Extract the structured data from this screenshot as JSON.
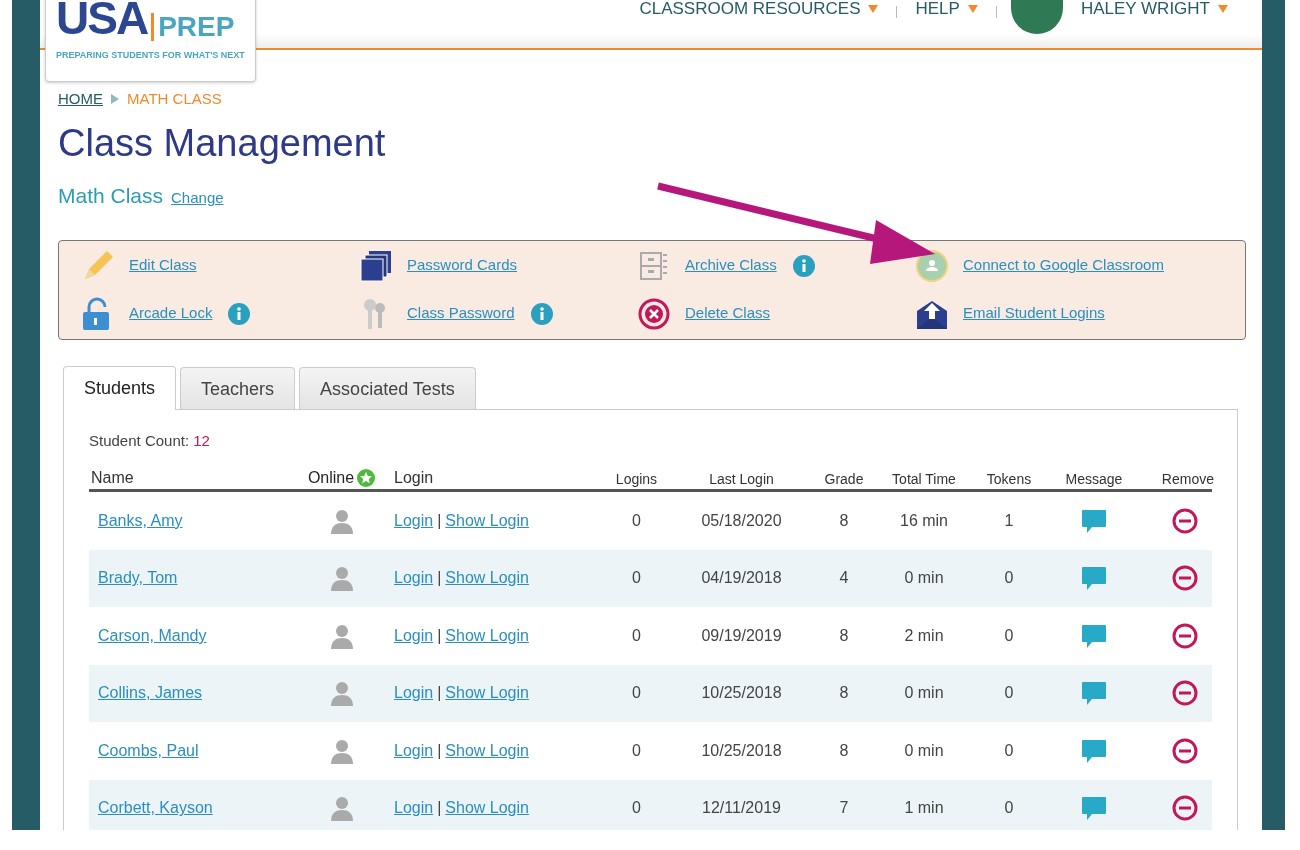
{
  "header": {
    "logo": {
      "main": "USA",
      "sub": "PREP",
      "tagline": "PREPARING STUDENTS FOR WHAT'S NEXT"
    },
    "nav": [
      {
        "label": "CLASSROOM RESOURCES",
        "kind": "menu"
      },
      {
        "label": "HELP",
        "kind": "menu"
      },
      {
        "label": "HALEY WRIGHT",
        "kind": "user"
      }
    ]
  },
  "breadcrumb": [
    {
      "label": "HOME",
      "kind": "link"
    },
    {
      "label": "MATH CLASS",
      "kind": "current"
    }
  ],
  "title": "Class Management",
  "class_name": "Math Class",
  "change_link": "Change",
  "actions": [
    {
      "label": "Edit Class",
      "kind": "pencil",
      "info": false
    },
    {
      "label": "Password Cards",
      "kind": "cards",
      "info": false
    },
    {
      "label": "Archive Class",
      "kind": "archive",
      "info": true
    },
    {
      "label": "Connect to Google Classroom",
      "kind": "classroom",
      "info": false
    },
    {
      "label": "Arcade Lock",
      "kind": "lock",
      "info": true
    },
    {
      "label": "Class Password",
      "kind": "keys",
      "info": true
    },
    {
      "label": "Delete Class",
      "kind": "delete",
      "info": false
    },
    {
      "label": "Email Student Logins",
      "kind": "email",
      "info": false
    }
  ],
  "tabs": [
    {
      "label": "Students",
      "selected": true
    },
    {
      "label": "Teachers",
      "selected": false
    },
    {
      "label": "Associated Tests",
      "selected": false
    }
  ],
  "student_count": {
    "label": "Student Count:",
    "value": "12"
  },
  "table": {
    "columns": [
      "Name",
      "Online",
      "Login",
      "Logins",
      "Last Login",
      "Grade",
      "Total Time",
      "Tokens",
      "Message",
      "Remove"
    ],
    "rows": [
      {
        "name": "Banks, Amy",
        "login_link": "Login",
        "separator": "|",
        "show_login_link": "Show Login",
        "logins": "0",
        "last_login": "05/18/2020",
        "grade": "8",
        "total_time": "16 min",
        "tokens": "1"
      },
      {
        "name": "Brady, Tom",
        "login_link": "Login",
        "separator": "|",
        "show_login_link": "Show Login",
        "logins": "0",
        "last_login": "04/19/2018",
        "grade": "4",
        "total_time": "0 min",
        "tokens": "0"
      },
      {
        "name": "Carson, Mandy",
        "login_link": "Login",
        "separator": "|",
        "show_login_link": "Show Login",
        "logins": "0",
        "last_login": "09/19/2019",
        "grade": "8",
        "total_time": "2 min",
        "tokens": "0"
      },
      {
        "name": "Collins, James",
        "login_link": "Login",
        "separator": "|",
        "show_login_link": "Show Login",
        "logins": "0",
        "last_login": "10/25/2018",
        "grade": "8",
        "total_time": "0 min",
        "tokens": "0"
      },
      {
        "name": "Coombs, Paul",
        "login_link": "Login",
        "separator": "|",
        "show_login_link": "Show Login",
        "logins": "0",
        "last_login": "10/25/2018",
        "grade": "8",
        "total_time": "0 min",
        "tokens": "0"
      },
      {
        "name": "Corbett, Kayson",
        "login_link": "Login",
        "separator": "|",
        "show_login_link": "Show Login",
        "logins": "0",
        "last_login": "12/11/2019",
        "grade": "7",
        "total_time": "1 min",
        "tokens": "0"
      }
    ]
  }
}
